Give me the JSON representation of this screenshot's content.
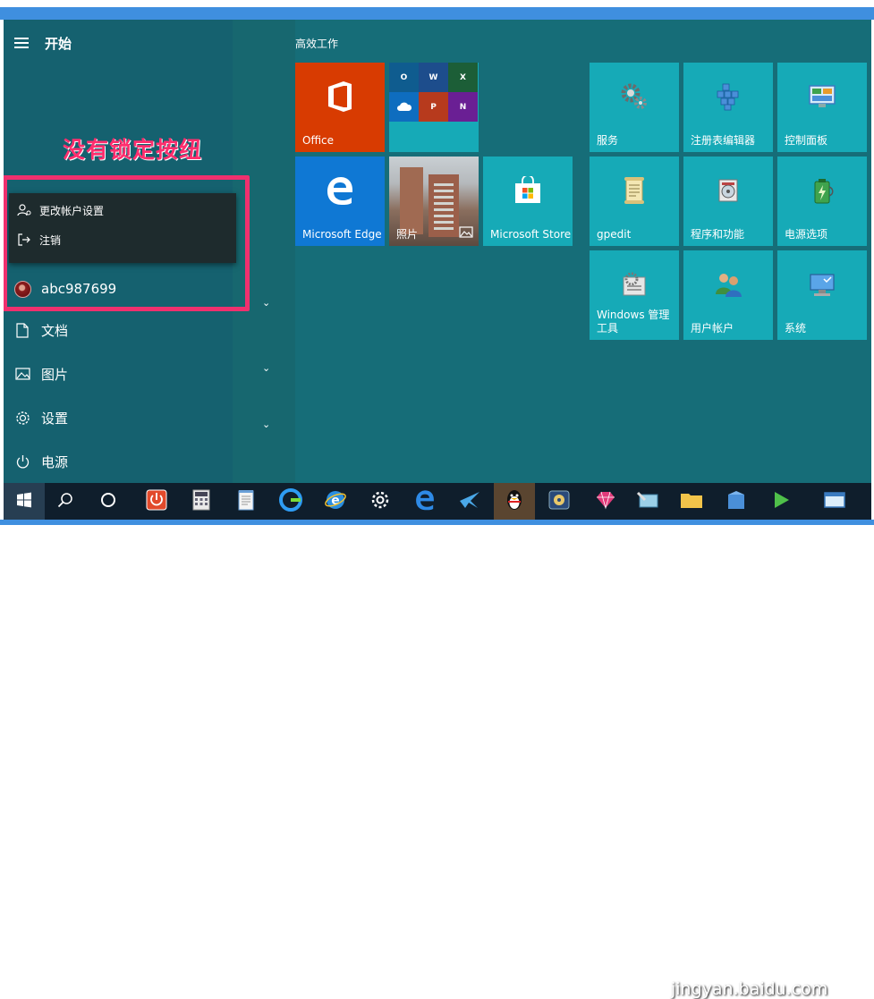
{
  "start_menu": {
    "title": "开始",
    "annotation": "没有锁定按纽",
    "account_menu": {
      "items": [
        {
          "label": "更改帐户设置",
          "icon": "person-settings-icon"
        },
        {
          "label": "注销",
          "icon": "sign-out-icon"
        }
      ]
    },
    "user": {
      "name": "abc987699"
    },
    "nav": [
      {
        "label": "文档",
        "icon": "document-icon"
      },
      {
        "label": "图片",
        "icon": "pictures-icon"
      },
      {
        "label": "设置",
        "icon": "gear-icon"
      },
      {
        "label": "电源",
        "icon": "power-icon"
      }
    ]
  },
  "tiles": {
    "group_title": "高效工作",
    "office": {
      "label": "Office"
    },
    "edge": {
      "label": "Microsoft Edge"
    },
    "photos": {
      "label": "照片"
    },
    "store": {
      "label": "Microsoft Store"
    },
    "office_apps": [
      {
        "letter": "O",
        "color": "#0072c6"
      },
      {
        "letter": "W",
        "color": "#2b579a"
      },
      {
        "letter": "X",
        "color": "#217346"
      },
      {
        "letter": "",
        "color": "#0078d4"
      },
      {
        "letter": "P",
        "color": "#d24726"
      },
      {
        "letter": "N",
        "color": "#7719aa"
      }
    ],
    "system": [
      {
        "label": "服务",
        "icon": "services-gear-icon"
      },
      {
        "label": "注册表编辑器",
        "icon": "registry-editor-icon"
      },
      {
        "label": "控制面板",
        "icon": "control-panel-icon"
      },
      {
        "label": "gpedit",
        "icon": "notepad-scroll-icon"
      },
      {
        "label": "程序和功能",
        "icon": "programs-icon"
      },
      {
        "label": "电源选项",
        "icon": "battery-icon"
      },
      {
        "label": "Windows 管理工具",
        "icon": "admin-tools-icon"
      },
      {
        "label": "用户帐户",
        "icon": "users-icon"
      },
      {
        "label": "系统",
        "icon": "computer-icon"
      }
    ]
  },
  "taskbar": {
    "watermark": "jingyan.baidu.com"
  }
}
